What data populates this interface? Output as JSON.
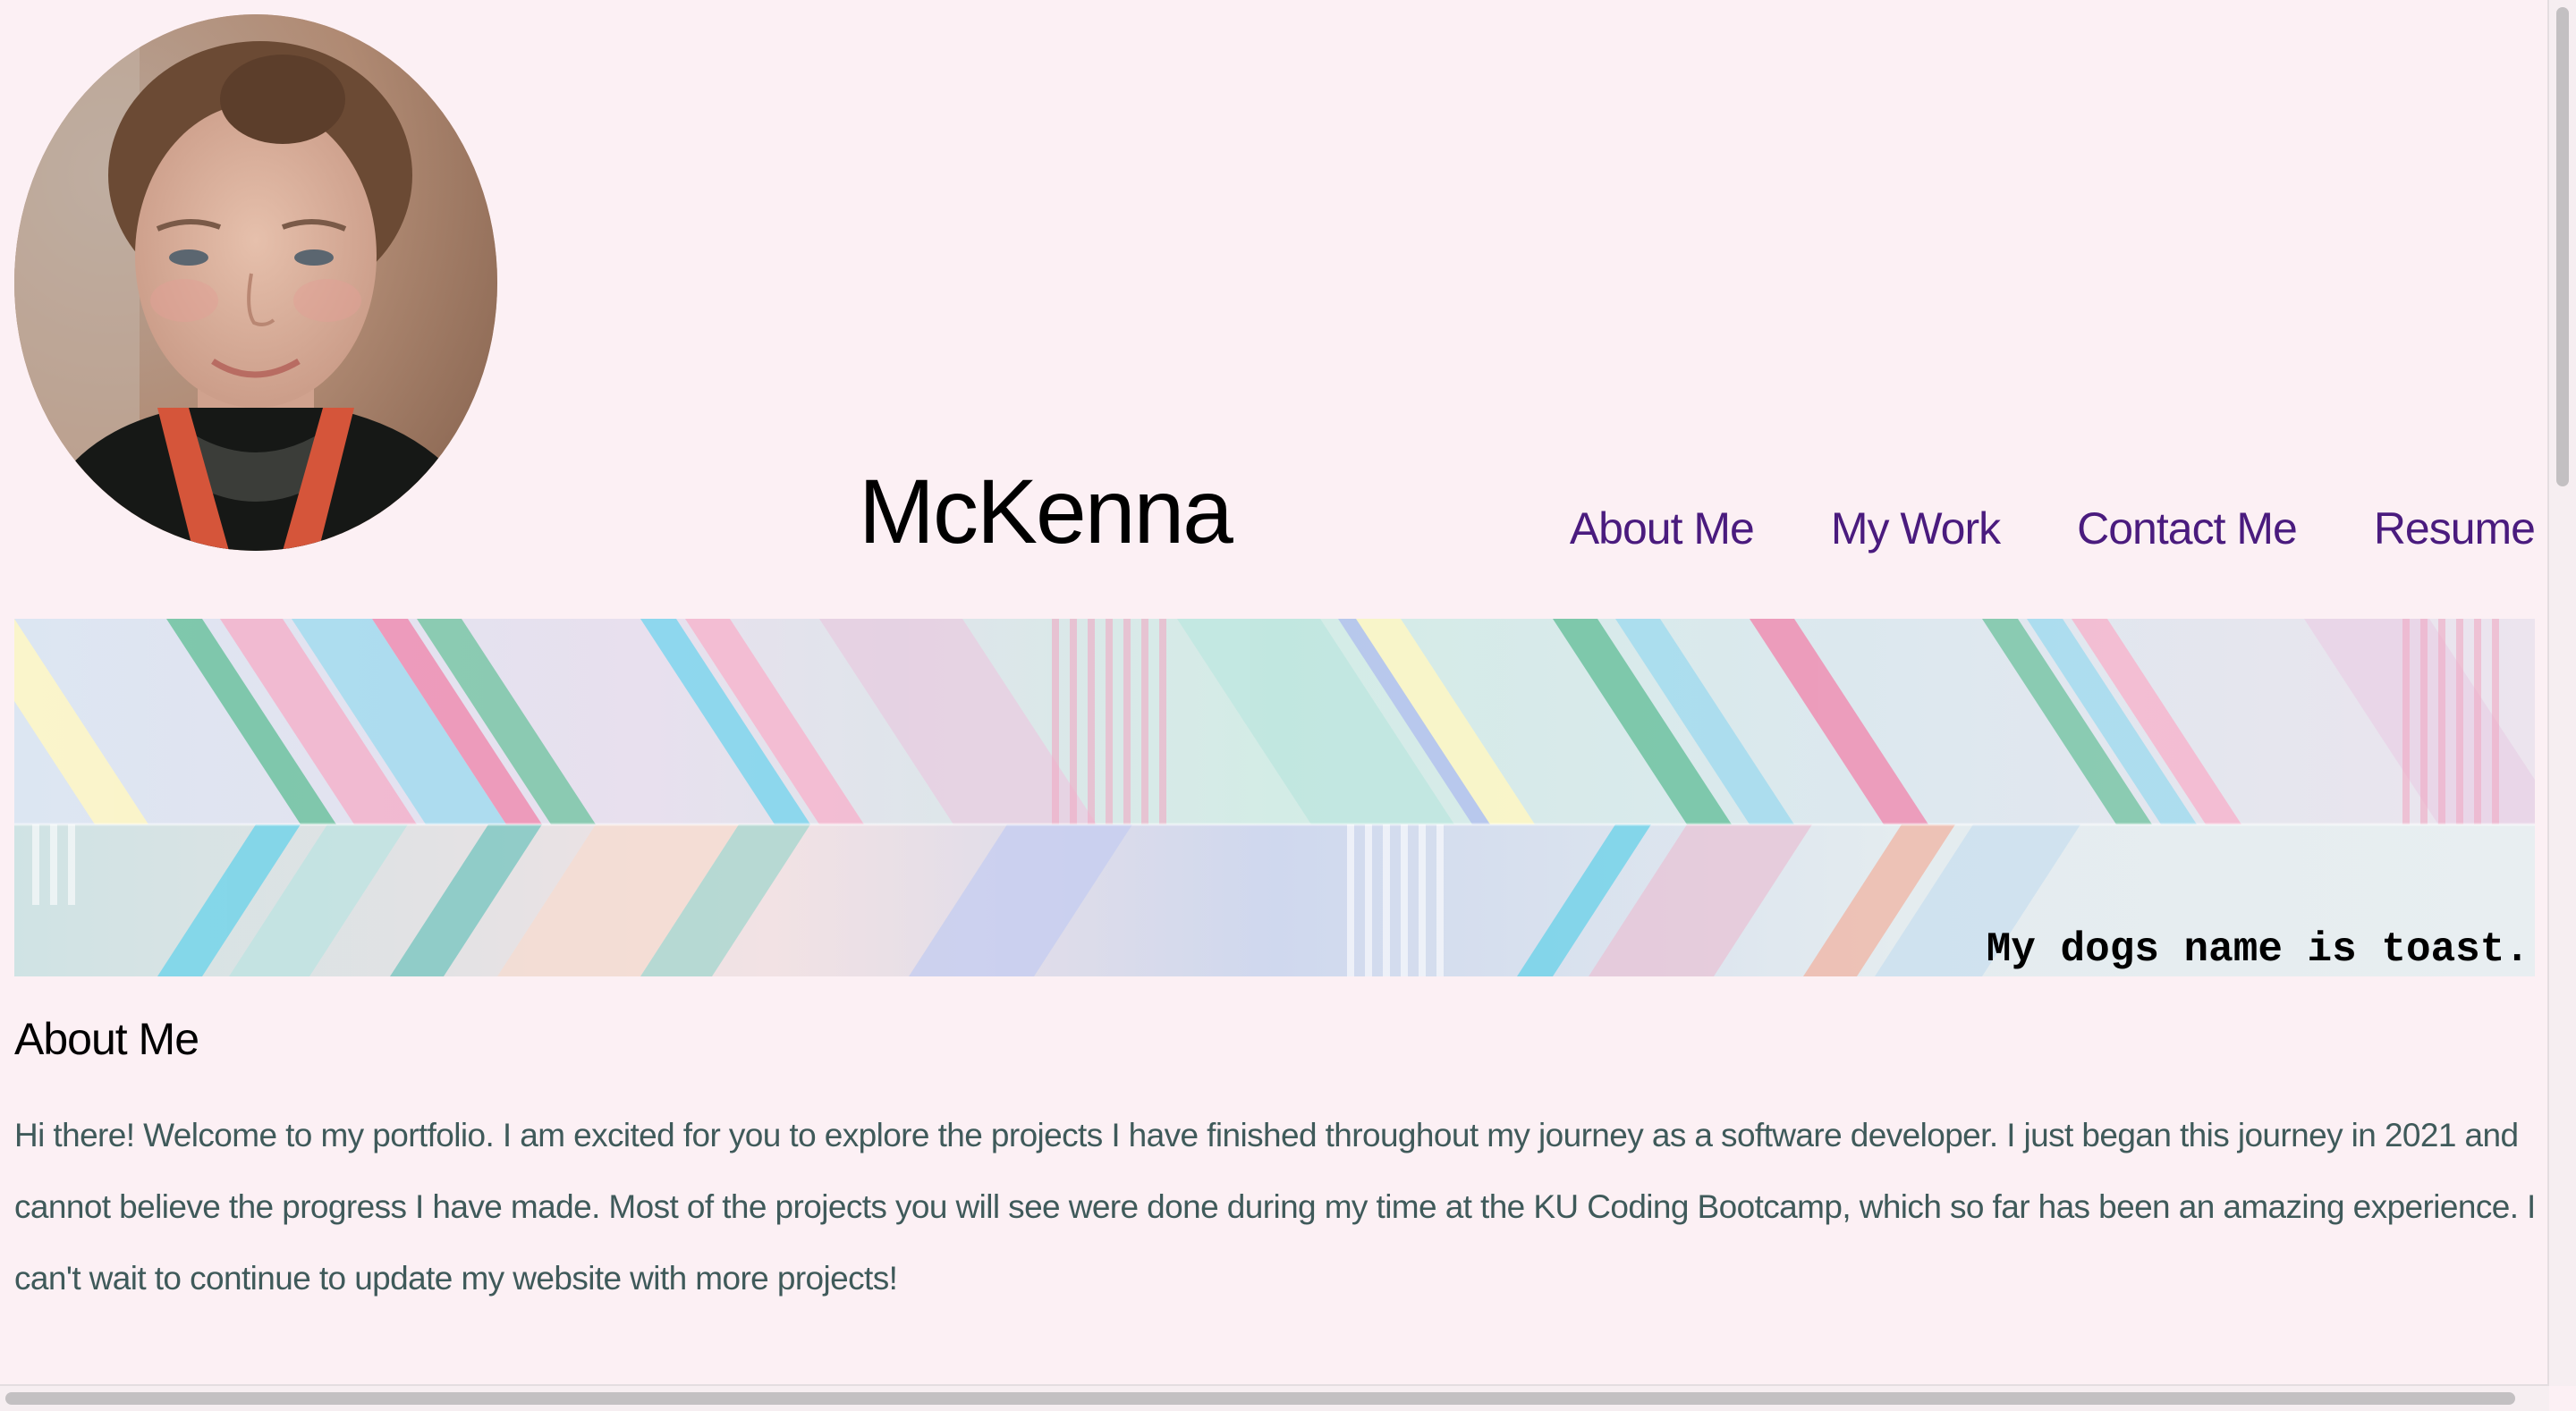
{
  "header": {
    "title": "McKenna",
    "avatar_icon": "profile-photo"
  },
  "nav": {
    "items": [
      {
        "label": "About Me"
      },
      {
        "label": "My Work"
      },
      {
        "label": "Contact Me"
      },
      {
        "label": "Resume"
      }
    ],
    "color": "#4a1b7e"
  },
  "banner": {
    "caption": "My dogs name is toast."
  },
  "about": {
    "heading": "About Me",
    "text": "Hi there! Welcome to my portfolio. I am excited for you to explore the projects I have finished throughout my journey as a software developer. I just began this journey in 2021 and cannot believe the progress I have made. Most of the projects you will see were done during my time at the KU Coding Bootcamp, which so far has been an amazing experience. I can't wait to continue to update my website with more projects!"
  },
  "colors": {
    "background": "#fcf0f4",
    "body_text": "#3f5a5a"
  }
}
